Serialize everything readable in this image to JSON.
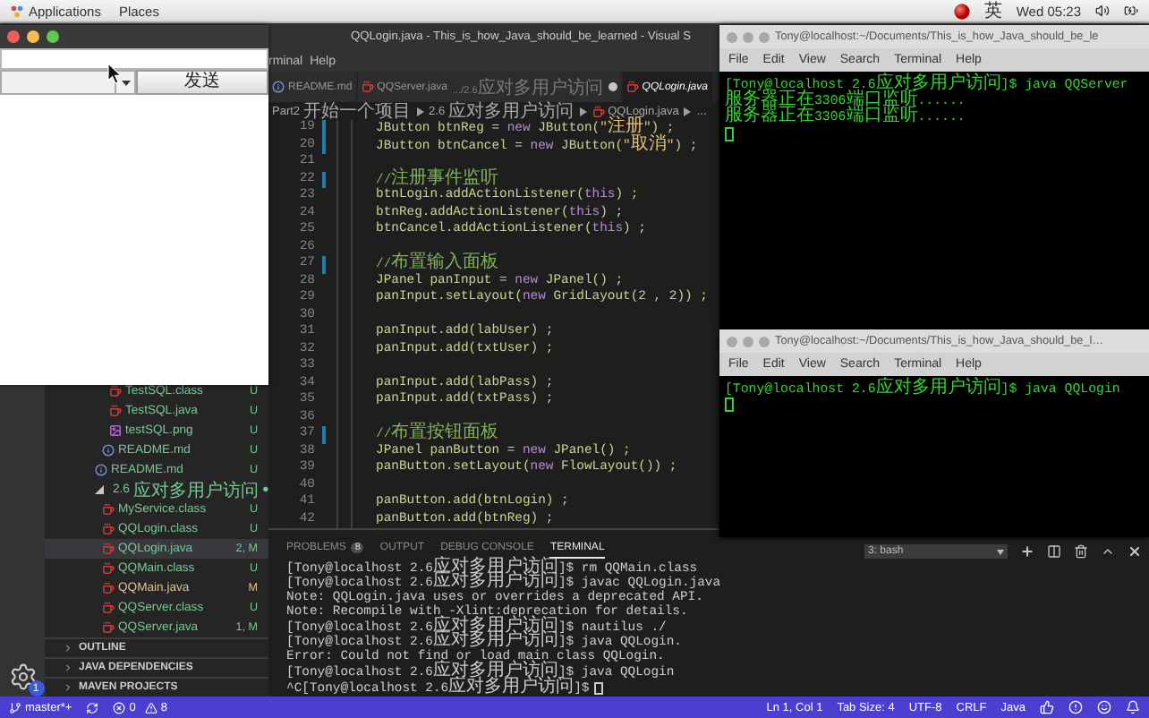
{
  "top_bar": {
    "menus": [
      "Applications",
      "Places"
    ],
    "input_method": "英",
    "clock": "Wed 05:23"
  },
  "java_window": {
    "send_button": "发送"
  },
  "vscode": {
    "title": "QQLogin.java - This_is_how_Java_should_be_learned - Visual S",
    "menu": [
      "rminal",
      "Help"
    ],
    "tabs": [
      {
        "label": "README.md",
        "kind": "readme",
        "dirty": false,
        "selected": false
      },
      {
        "label": "QQServer.java",
        "description": ".../2.6应对多用户访问",
        "kind": "java",
        "dirty": true,
        "selected": false
      },
      {
        "label": "QQLogin.java",
        "kind": "java",
        "dirty": false,
        "selected": true
      }
    ],
    "breadcrumbs": [
      "Part2开始一个项目",
      "2.6应对多用户访问",
      "QQLogin.java",
      "..."
    ],
    "code_lines": [
      {
        "number": "19",
        "modified": true,
        "tokens": [
          {
            "kind": "plain",
            "text": "JButton btnReg = "
          },
          {
            "kind": "keyword",
            "text": "new"
          },
          {
            "kind": "plain",
            "text": " JButton("
          },
          {
            "kind": "string",
            "text": "\"注册\""
          },
          {
            "kind": "plain",
            "text": ") ;"
          }
        ]
      },
      {
        "number": "20",
        "modified": true,
        "tokens": [
          {
            "kind": "plain",
            "text": "JButton btnCancel = "
          },
          {
            "kind": "keyword",
            "text": "new"
          },
          {
            "kind": "plain",
            "text": " JButton("
          },
          {
            "kind": "string",
            "text": "\"取消\""
          },
          {
            "kind": "plain",
            "text": ") ;"
          }
        ]
      },
      {
        "number": "21",
        "modified": false
      },
      {
        "number": "22",
        "modified": true,
        "tokens": [
          {
            "kind": "comment",
            "text": "//注册事件监听"
          }
        ]
      },
      {
        "number": "23",
        "modified": false,
        "tokens": [
          {
            "kind": "plain",
            "text": "btnLogin.addActionListener("
          },
          {
            "kind": "keyword",
            "text": "this"
          },
          {
            "kind": "plain",
            "text": ") ;"
          }
        ]
      },
      {
        "number": "24",
        "modified": false,
        "tokens": [
          {
            "kind": "plain",
            "text": "btnReg.addActionListener("
          },
          {
            "kind": "keyword",
            "text": "this"
          },
          {
            "kind": "plain",
            "text": ") ;"
          }
        ]
      },
      {
        "number": "25",
        "modified": false,
        "tokens": [
          {
            "kind": "plain",
            "text": "btnCancel.addActionListener("
          },
          {
            "kind": "keyword",
            "text": "this"
          },
          {
            "kind": "plain",
            "text": ") ;"
          }
        ]
      },
      {
        "number": "26",
        "modified": false
      },
      {
        "number": "27",
        "modified": true,
        "tokens": [
          {
            "kind": "comment",
            "text": "//布置输入面板"
          }
        ]
      },
      {
        "number": "28",
        "modified": false,
        "tokens": [
          {
            "kind": "plain",
            "text": "JPanel panInput = "
          },
          {
            "kind": "keyword",
            "text": "new"
          },
          {
            "kind": "plain",
            "text": " JPanel() ;"
          }
        ]
      },
      {
        "number": "29",
        "modified": false,
        "tokens": [
          {
            "kind": "plain",
            "text": "panInput.setLayout("
          },
          {
            "kind": "keyword",
            "text": "new"
          },
          {
            "kind": "plain",
            "text": " GridLayout(2 , 2)) ;"
          }
        ]
      },
      {
        "number": "30",
        "modified": false
      },
      {
        "number": "31",
        "modified": false,
        "tokens": [
          {
            "kind": "plain",
            "text": "panInput.add(labUser) ;"
          }
        ]
      },
      {
        "number": "32",
        "modified": false,
        "tokens": [
          {
            "kind": "plain",
            "text": "panInput.add(txtUser) ;"
          }
        ]
      },
      {
        "number": "33",
        "modified": false
      },
      {
        "number": "34",
        "modified": false,
        "tokens": [
          {
            "kind": "plain",
            "text": "panInput.add(labPass) ;"
          }
        ]
      },
      {
        "number": "35",
        "modified": false,
        "tokens": [
          {
            "kind": "plain",
            "text": "panInput.add(txtPass) ;"
          }
        ]
      },
      {
        "number": "36",
        "modified": false
      },
      {
        "number": "37",
        "modified": true,
        "tokens": [
          {
            "kind": "comment",
            "text": "//布置按钮面板"
          }
        ]
      },
      {
        "number": "38",
        "modified": false,
        "tokens": [
          {
            "kind": "plain",
            "text": "JPanel panButton = "
          },
          {
            "kind": "keyword",
            "text": "new"
          },
          {
            "kind": "plain",
            "text": " JPanel() ;"
          }
        ]
      },
      {
        "number": "39",
        "modified": false,
        "tokens": [
          {
            "kind": "plain",
            "text": "panButton.setLayout("
          },
          {
            "kind": "keyword",
            "text": "new"
          },
          {
            "kind": "plain",
            "text": " FlowLayout()) ;"
          }
        ]
      },
      {
        "number": "40",
        "modified": false
      },
      {
        "number": "41",
        "modified": false,
        "tokens": [
          {
            "kind": "plain",
            "text": "panButton.add(btnLogin) ;"
          }
        ]
      },
      {
        "number": "42",
        "modified": false,
        "tokens": [
          {
            "kind": "plain",
            "text": "panButton.add(btnReg) ;"
          }
        ]
      }
    ],
    "explorer": {
      "tree": [
        {
          "children": [
            {
              "children": [
                {
                  "name": "TestSQL.class",
                  "kind": "java",
                  "status": "U",
                  "color": "#73c991",
                  "selected": false
                },
                {
                  "name": "TestSQL.java",
                  "kind": "java",
                  "status": "U",
                  "color": "#73c991",
                  "selected": false
                },
                {
                  "name": "testSQL.png",
                  "kind": "image",
                  "status": "U",
                  "color": "#73c991",
                  "selected": false
                }
              ]
            },
            {
              "name": "README.md",
              "kind": "readme",
              "status": "U",
              "color": "#73c991",
              "selected": false
            }
          ]
        },
        {
          "name": "README.md",
          "kind": "readme",
          "status": "U",
          "color": "#73c991",
          "selected": false
        },
        {
          "name": "2.6应对多用户访问",
          "kind": "folder",
          "status": "●",
          "color": "#73c991",
          "selected": false,
          "expanded": true,
          "children": [
            {
              "name": "MyService.class",
              "kind": "java",
              "status": "U",
              "color": "#73c991",
              "selected": false
            },
            {
              "name": "QQLogin.class",
              "kind": "java",
              "status": "U",
              "color": "#73c991",
              "selected": false
            },
            {
              "name": "QQLogin.java",
              "kind": "java",
              "status": "2, M",
              "color": "#73c991",
              "selected": true
            },
            {
              "name": "QQMain.class",
              "kind": "java",
              "status": "U",
              "color": "#73c991",
              "selected": false
            },
            {
              "name": "QQMain.java",
              "kind": "java",
              "status": "M",
              "color": "#e2c08d",
              "selected": false
            },
            {
              "name": "QQServer.class",
              "kind": "java",
              "status": "U",
              "color": "#73c991",
              "selected": false
            },
            {
              "name": "QQServer.java",
              "kind": "java",
              "status": "1, M",
              "color": "#73c991",
              "selected": false
            }
          ]
        }
      ],
      "sections": [
        {
          "label": "OUTLINE",
          "expanded": false
        },
        {
          "label": "JAVA DEPENDENCIES",
          "expanded": false
        },
        {
          "label": "MAVEN PROJECTS",
          "expanded": false
        }
      ]
    },
    "settings_badge": "1",
    "panel": {
      "tabs": [
        {
          "label": "PROBLEMS",
          "badge": "8",
          "selected": false
        },
        {
          "label": "OUTPUT",
          "selected": false
        },
        {
          "label": "DEBUG CONSOLE",
          "selected": false
        },
        {
          "label": "TERMINAL",
          "selected": true
        }
      ],
      "terminal_select": "3: bash",
      "terminal_lines": [
        "[Tony@localhost 2.6应对多用户访问]$ rm QQMain.class",
        "[Tony@localhost 2.6应对多用户访问]$ javac QQLogin.java",
        "Note: QQLogin.java uses or overrides a deprecated API.",
        "Note: Recompile with -Xlint:deprecation for details.",
        "[Tony@localhost 2.6应对多用户访问]$ nautilus ./",
        "[Tony@localhost 2.6应对多用户访问]$ java QQLogin.",
        "Error: Could not find or load main class QQLogin.",
        "[Tony@localhost 2.6应对多用户访问]$ java QQLogin",
        "^C[Tony@localhost 2.6应对多用户访问]$"
      ]
    },
    "status_bar": {
      "branch": "master*+",
      "errors": "0",
      "warnings": "8",
      "items": [
        "Ln 1, Col 1",
        "Tab Size: 4",
        "UTF-8",
        "CRLF",
        "Java"
      ]
    }
  },
  "terminals": [
    {
      "title": "Tony@localhost:~/Documents/This_is_how_Java_should_be_le",
      "menu": [
        "File",
        "Edit",
        "View",
        "Search",
        "Terminal",
        "Help"
      ],
      "lines": [
        "[Tony@localhost 2.6应对多用户访问]$ java QQServer",
        "服务器正在3306端口监听......",
        "服务器正在3306端口监听......"
      ]
    },
    {
      "title": "Tony@localhost:~/Documents/This_is_how_Java_should_be_l…",
      "menu": [
        "File",
        "Edit",
        "View",
        "Search",
        "Terminal",
        "Help"
      ],
      "lines": [
        "[Tony@localhost 2.6应对多用户访问]$ java QQLogin"
      ]
    }
  ]
}
